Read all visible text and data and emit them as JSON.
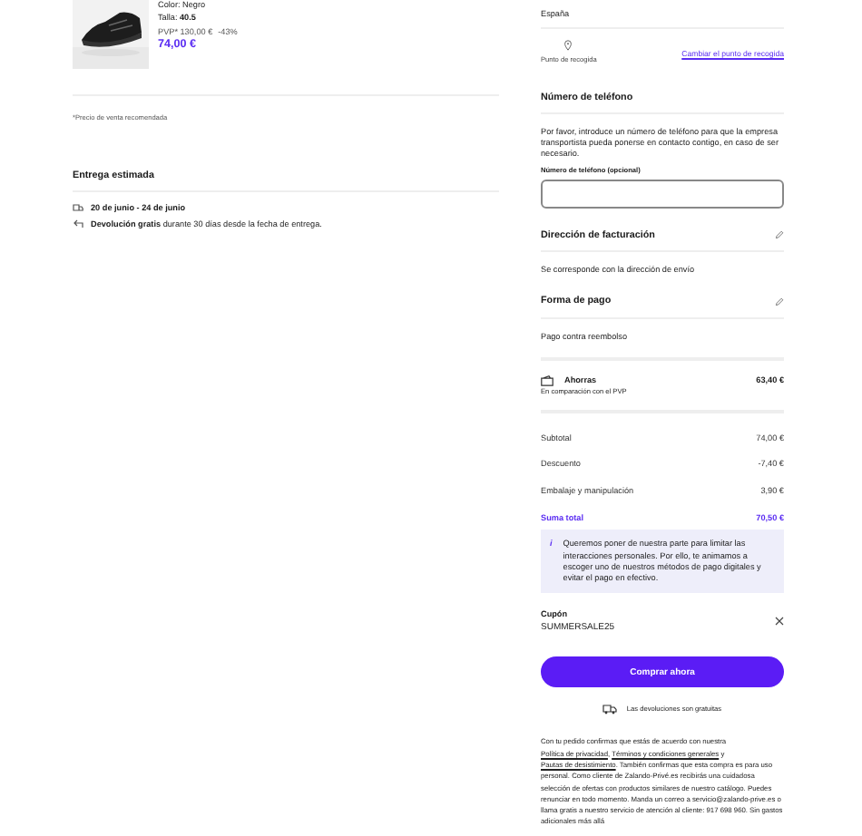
{
  "product": {
    "variant": "Color: Negro",
    "size": "Talla: **40.5**",
    "rrp": "PVP* 130,00 €",
    "discount": "-43%",
    "price": "74,00 €"
  },
  "footnote": "*Precio de venta recomendada",
  "delivery": {
    "title": "Entrega estimada",
    "dates": "20 de junio - 24 de junio",
    "returns": "**Devolución gratis** durante 30 días desde la fecha de entrega."
  },
  "address": {
    "country": "España",
    "pickup_label": "Punto de recogida",
    "change_link": "Cambiar el punto de recogida"
  },
  "phone": {
    "title": "Número de teléfono",
    "text": "Por favor, introduce un número de teléfono para que la empresa transportista pueda ponerse en contacto contigo, en caso de ser necesario.",
    "field_label": "Número de teléfono (opcional)"
  },
  "billing": {
    "title": "Dirección de facturación",
    "text": "Se corresponde con la dirección de envío"
  },
  "payment": {
    "title": "Forma de pago",
    "text": "Pago contra reembolso"
  },
  "savings": {
    "title": "Ahorras",
    "amount": "63,40 €",
    "note": "En comparación con el PVP"
  },
  "totals": [
    {
      "label": "Subtotal",
      "value": "74,00 €",
      "kind": "line"
    },
    {
      "label": "Descuento",
      "value": "-7,40 €",
      "kind": "line"
    },
    {
      "label": "Embalaje y manipulación",
      "value": "3,90 €",
      "kind": "line"
    },
    {
      "label": "Suma total",
      "value": "70,50 €",
      "kind": "total"
    }
  ],
  "notice": {
    "icon": "i",
    "text": "Queremos poner de nuestra parte para limitar las interacciones personales. Por ello, te animamos a escoger uno de nuestros métodos de pago digitales y evitar el pago en efectivo."
  },
  "coupon": {
    "label": "Cupón",
    "code": "SUMMERSALE25"
  },
  "buy_button": "Comprar ahora",
  "returns_note": "Las devoluciones son gratuitas",
  "legal": [
    {
      "text": "Con tu pedido confirmas que estás de acuerdo con nuestra ",
      "kind": "text"
    },
    {
      "text": "Política de privacidad",
      "kind": "link"
    },
    {
      "text": ", ",
      "kind": "text"
    },
    {
      "text": "Términos y condiciones generales",
      "kind": "link"
    },
    {
      "text": " y ",
      "kind": "text"
    },
    {
      "text": "Pautas de desistimiento",
      "kind": "link"
    },
    {
      "text": ". También confirmas que esta compra es para uso personal. Como cliente de Zalando-Privé.es recibirás una cuidadosa selección de ofertas con productos similares de nuestro catálogo. Puedes renunciar en todo momento. Manda un correo a servicio@zalando-prive.es o llama gratis a nuestro servicio de atención al cliente: 917 698 960. Sin gastos adicionales más allá",
      "kind": "text"
    }
  ]
}
